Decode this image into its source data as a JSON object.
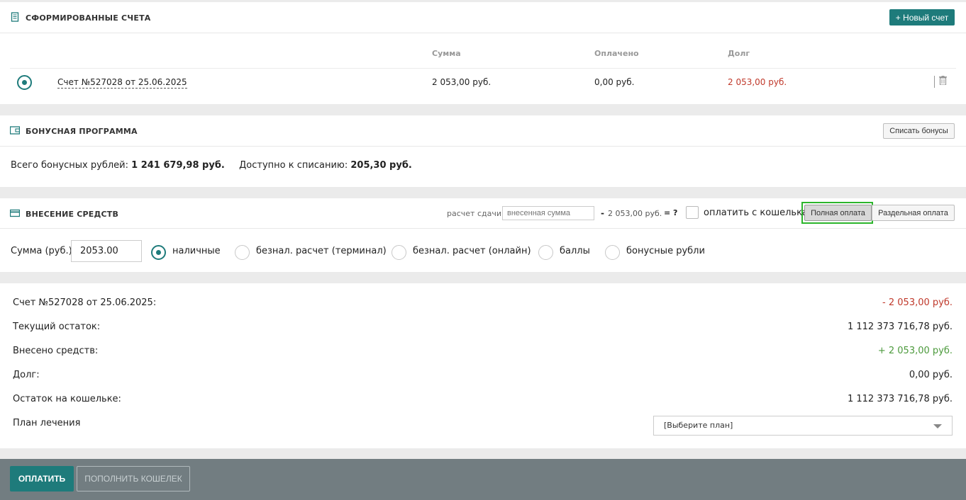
{
  "invoices": {
    "title": "СФОРМИРОВАННЫЕ СЧЕТА",
    "new_button": "+ Новый счет",
    "columns": {
      "sum": "Сумма",
      "paid": "Оплачено",
      "debt": "Долг"
    },
    "rows": [
      {
        "name": "Счет №527028 от 25.06.2025",
        "sum": "2 053,00 руб.",
        "paid": "0,00 руб.",
        "debt": "2 053,00 руб."
      }
    ]
  },
  "bonus": {
    "title": "БОНУСНАЯ ПРОГРАММА",
    "writeoff_button": "Списать бонусы",
    "total_label": "Всего бонусных рублей:",
    "total_value": "1 241 679,98 руб.",
    "available_label": "Доступно к списанию:",
    "available_value": "205,30 руб."
  },
  "funds": {
    "title": "ВНЕСЕНИЕ СРЕДСТВ",
    "change_label": "расчет сдачи:",
    "change_placeholder": "внесенная сумма",
    "minus": "-",
    "amount": "2 053,00 руб.",
    "equals": "= ?",
    "wallet_label": "оплатить с кошелька",
    "full_button": "Полная оплата",
    "split_button": "Раздельная оплата",
    "sum_label": "Сумма (руб.):",
    "sum_value": "2053.00",
    "options": [
      "наличные",
      "безнал. расчет (терминал)",
      "безнал. расчет (онлайн)",
      "баллы",
      "бонусные рубли"
    ]
  },
  "summary": {
    "rows": [
      {
        "label": "Счет №527028 от 25.06.2025:",
        "value": "- 2 053,00 руб."
      },
      {
        "label": "Текущий остаток:",
        "value": "1 112 373 716,78 руб."
      },
      {
        "label": "Внесено средств:",
        "value": "+ 2 053,00 руб."
      },
      {
        "label": "Долг:",
        "value": "0,00 руб."
      },
      {
        "label": "Остаток на кошельке:",
        "value": "1 112 373 716,78 руб."
      }
    ],
    "plan_label": "План лечения",
    "plan_select": "[Выберите план]"
  },
  "footer": {
    "pay_button": "ОПЛАТИТЬ",
    "topup_button": "ПОПОЛНИТЬ КОШЕЛЕК"
  },
  "colors": {
    "accent": "#1e7b7b",
    "negative": "#c0392b",
    "positive": "#4c9a3c",
    "footer": "#727d81",
    "highlight": "#2cb52c"
  }
}
